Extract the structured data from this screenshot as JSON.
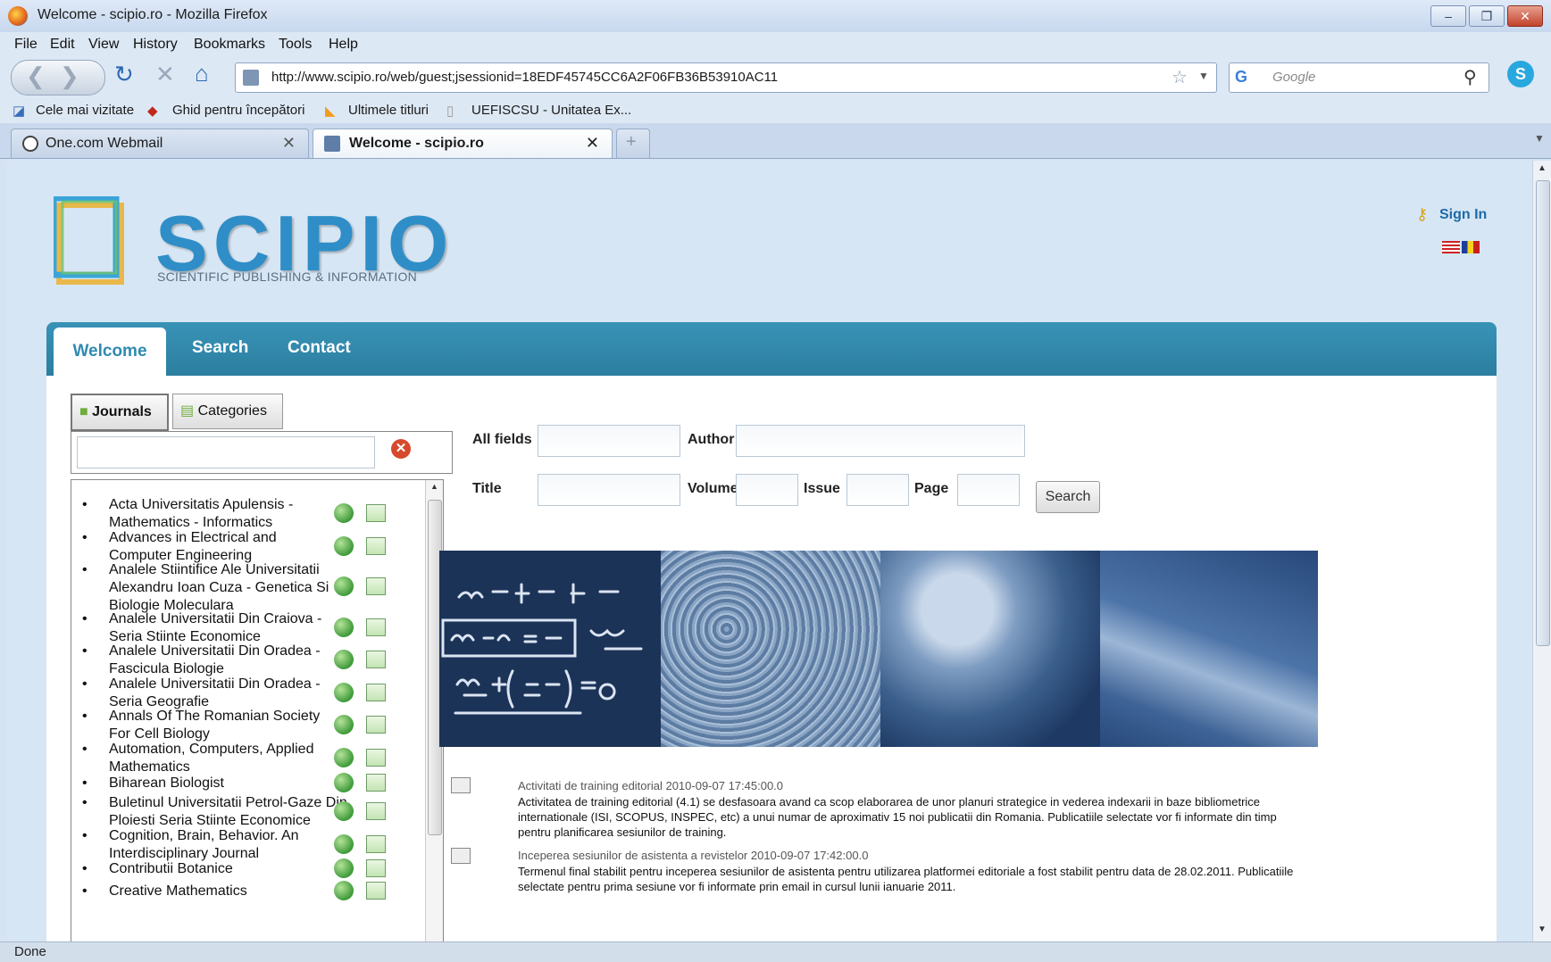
{
  "window": {
    "title": "Welcome - scipio.ro - Mozilla Firefox"
  },
  "menu": [
    "File",
    "Edit",
    "View",
    "History",
    "Bookmarks",
    "Tools",
    "Help"
  ],
  "toolbar": {
    "url": "http://www.scipio.ro/web/guest;jsessionid=18EDF45745CC6A2F06FB36B53910AC11",
    "search_placeholder": "Google"
  },
  "bookmarks": [
    "Cele mai vizitate",
    "Ghid pentru începători",
    "Ultimele titluri",
    "UEFISCSU - Unitatea Ex..."
  ],
  "tabs": [
    {
      "label": "One.com Webmail",
      "active": false
    },
    {
      "label": "Welcome - scipio.ro",
      "active": true
    }
  ],
  "header": {
    "logo_title": "SCIPIO",
    "logo_subtitle": "SCIENTIFIC PUBLISHING & INFORMATION",
    "sign_in": "Sign In"
  },
  "nav": [
    "Welcome",
    "Search",
    "Contact"
  ],
  "sidebar": {
    "journals_label": "Journals",
    "categories_label": "Categories",
    "journals": [
      "Acta Universitatis Apulensis - Mathematics - Informatics",
      "Advances in Electrical and Computer Engineering",
      "Analele Stiintifice Ale Universitatii Alexandru Ioan Cuza - Genetica Si Biologie Moleculara",
      "Analele Universitatii Din Craiova - Seria Stiinte Economice",
      "Analele Universitatii Din Oradea - Fascicula Biologie",
      "Analele Universitatii Din Oradea - Seria Geografie",
      "Annals Of The Romanian Society For Cell Biology",
      "Automation, Computers, Applied Mathematics",
      "Biharean Biologist",
      "Buletinul Universitatii Petrol-Gaze Din Ploiesti Seria Stiinte Economice",
      "Cognition, Brain, Behavior. An Interdisciplinary Journal",
      "Contributii Botanice",
      "Creative Mathematics"
    ]
  },
  "search": {
    "all_fields": "All fields",
    "author": "Author",
    "title": "Title",
    "volume": "Volume",
    "issue": "Issue",
    "page": "Page",
    "button": "Search"
  },
  "news": [
    {
      "title": "Activitati de training editorial 2010-09-07 17:45:00.0",
      "body": "Activitatea de training editorial (4.1) se desfasoara avand ca scop elaborarea de unor planuri strategice in vederea indexarii in baze bibliometrice internationale (ISI, SCOPUS, INSPEC, etc) a unui numar de aproximativ 15 noi publicatii din Romania. Publicatiile selectate vor fi informate din timp pentru planificarea sesiunilor de training."
    },
    {
      "title": "Inceperea sesiunilor de asistenta a revistelor 2010-09-07 17:42:00.0",
      "body": "Termenul final stabilit pentru inceperea sesiunilor de asistenta pentru utilizarea platformei editoriale a fost stabilit pentru data de 28.02.2011. Publicatiile selectate pentru prima sesiune vor fi informate prin email in cursul lunii ianuarie 2011."
    }
  ],
  "status": "Done"
}
